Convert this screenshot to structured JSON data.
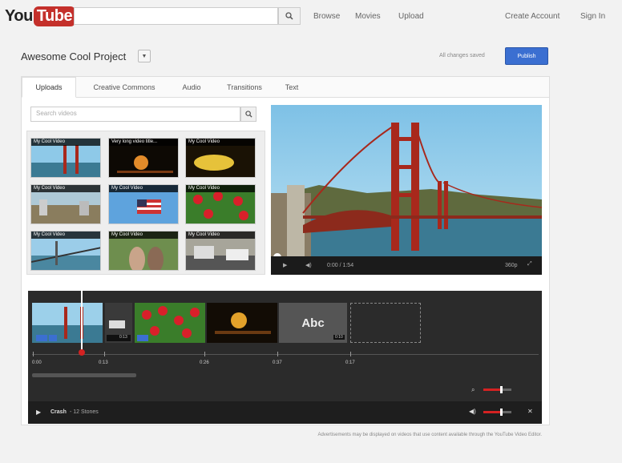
{
  "header": {
    "logo_you": "You",
    "logo_tube": "Tube",
    "search_placeholder": "",
    "nav": {
      "browse": "Browse",
      "movies": "Movies",
      "upload": "Upload"
    },
    "account": {
      "create": "Create Account",
      "sign_in": "Sign In"
    }
  },
  "project": {
    "title": "Awesome Cool Project",
    "saved_status": "All changes saved",
    "publish_label": "Publish"
  },
  "tabs": [
    {
      "label": "Uploads",
      "active": true
    },
    {
      "label": "Creative Commons",
      "active": false
    },
    {
      "label": "Audio",
      "active": false
    },
    {
      "label": "Transitions",
      "active": false
    },
    {
      "label": "Text",
      "active": false
    }
  ],
  "library": {
    "search_placeholder": "Search videos",
    "videos": [
      {
        "title": "My Cool Video",
        "scene": "bridge"
      },
      {
        "title": "Very long video title...",
        "scene": "night"
      },
      {
        "title": "My Cool Video",
        "scene": "lights"
      },
      {
        "title": "My Cool Video",
        "scene": "city"
      },
      {
        "title": "My Cool Video",
        "scene": "flag"
      },
      {
        "title": "My Cool Video",
        "scene": "flowers"
      },
      {
        "title": "My Cool Video",
        "scene": "bridge2"
      },
      {
        "title": "My Cool Video",
        "scene": "people"
      },
      {
        "title": "My Cool Video",
        "scene": "street"
      }
    ]
  },
  "player": {
    "time": "0:00 / 1:54",
    "quality": "360p"
  },
  "timeline": {
    "text_clip_label": "Abc",
    "ticks": [
      "0:00",
      "0:13",
      "0:26",
      "0:37",
      "0:17"
    ],
    "clip_durations": [
      "0:13",
      "0:10"
    ]
  },
  "bottombar": {
    "track_name": "Crash",
    "track_artist": "- 12 Stones"
  },
  "footnote": "Advertisements may be displayed on videos that use content available through the YouTube Video Editor.",
  "colors": {
    "accent": "#3b6fd1",
    "brand": "#c4302b",
    "playhead": "#d42222"
  }
}
